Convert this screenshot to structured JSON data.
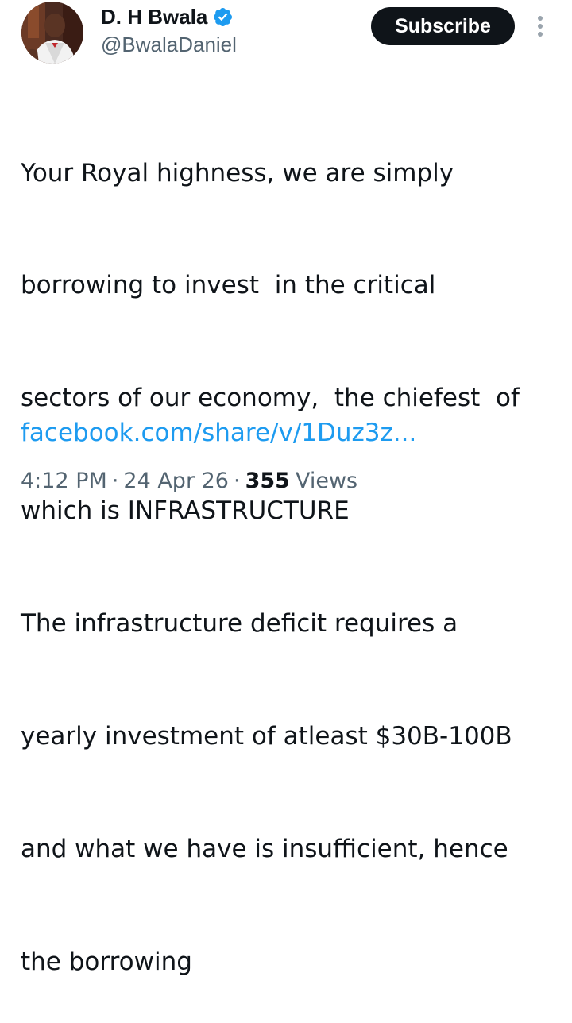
{
  "author": {
    "display_name": "D. H Bwala",
    "handle": "@BwalaDaniel",
    "verified_color": "#1d9bf0",
    "avatar_icon": "profile-photo"
  },
  "actions": {
    "subscribe_label": "Subscribe",
    "more_icon": "more-vertical-icon"
  },
  "tweet": {
    "text_lines": [
      "Your Royal highness, we are simply",
      "borrowing to invest  in the critical",
      "sectors of our economy,  the chiefest  of",
      "which is INFRASTRUCTURE",
      "The infrastructure deficit requires a",
      "yearly investment of atleast $30B-100B",
      "and what we have is insufficient, hence",
      "the borrowing"
    ],
    "link_text": "facebook.com/share/v/1Duz3z..."
  },
  "meta": {
    "time": "4:12 PM",
    "separator": "·",
    "date": "24 Apr 26",
    "views_count": "355",
    "views_label": "Views"
  },
  "colors": {
    "text": "#0f1419",
    "muted": "#536471",
    "link": "#1d9bf0",
    "button_bg": "#0f1419"
  }
}
